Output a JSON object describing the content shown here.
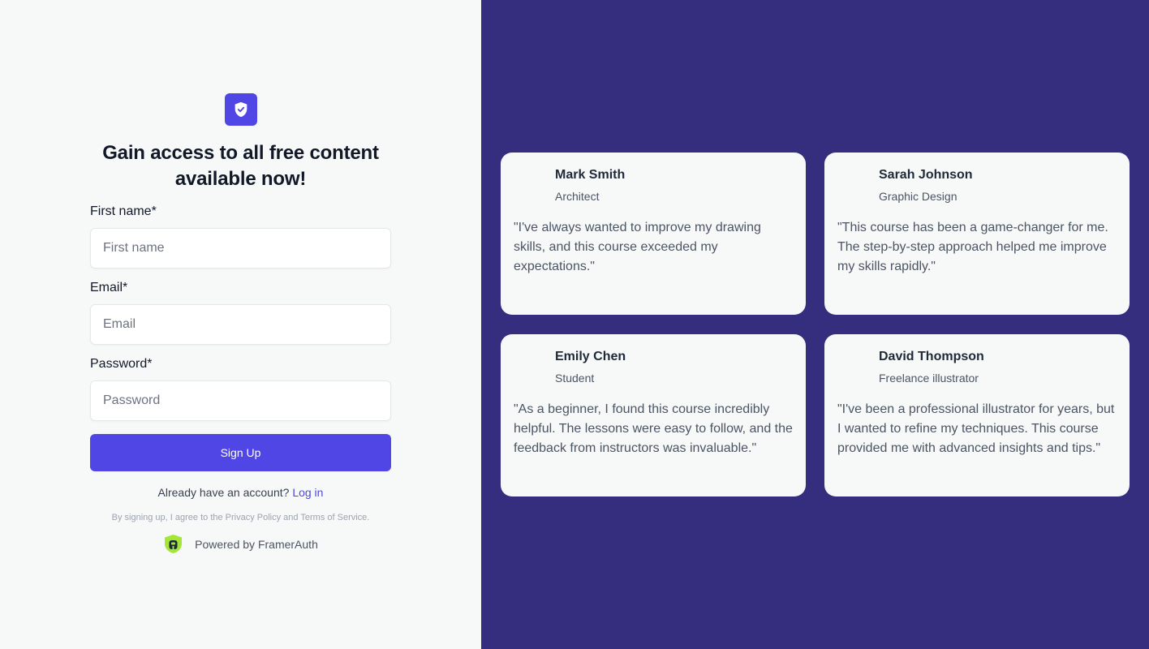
{
  "colors": {
    "left_bg": "#f7f8f8",
    "right_bg": "#352d7d",
    "accent": "#4f46e5",
    "card_bg": "#f7f8f8",
    "powered_logo": "#a3e635"
  },
  "form": {
    "logo_icon": "shield-check-icon",
    "headline": "Gain access to all free content available now!",
    "fields": [
      {
        "label": "First name*",
        "placeholder": "First name",
        "value": ""
      },
      {
        "label": "Email*",
        "placeholder": "Email",
        "value": ""
      },
      {
        "label": "Password*",
        "placeholder": "Password",
        "value": ""
      }
    ],
    "signup_label": "Sign Up",
    "already_text": "Already have an account?",
    "login_link": "Log in",
    "terms_text": "By signing up, I agree to the Privacy Policy and Terms of Service.",
    "powered_icon": "framerauth-logo-icon",
    "powered_text": "Powered by FramerAuth"
  },
  "testimonials": [
    {
      "name": "Mark Smith",
      "role": "Architect",
      "quote": "\"I've always wanted to improve my drawing skills, and this course exceeded my expectations.\""
    },
    {
      "name": "Sarah Johnson",
      "role": "Graphic Design",
      "quote": "\"This course has been a game-changer for me. The step-by-step approach helped me improve my skills rapidly.\""
    },
    {
      "name": "Emily Chen",
      "role": "Student",
      "quote": "\"As a beginner, I found this course incredibly helpful. The lessons were easy to follow, and the feedback from instructors was invaluable.\""
    },
    {
      "name": "David Thompson",
      "role": "Freelance illustrator",
      "quote": "\"I've been a professional illustrator for years, but I wanted to refine my techniques. This course provided me with advanced insights and tips.\""
    }
  ]
}
